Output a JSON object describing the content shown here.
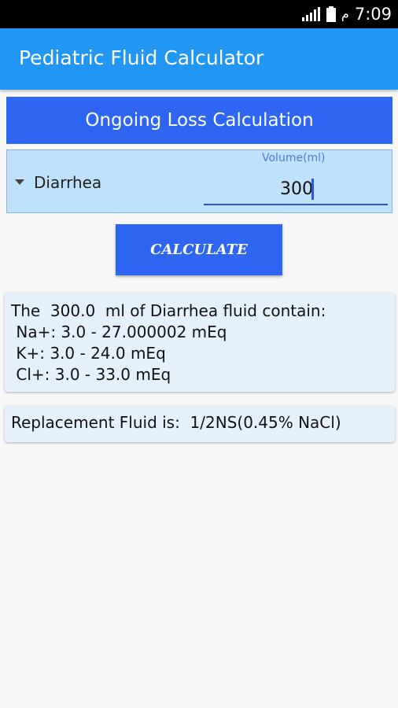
{
  "status_bar": {
    "time": "7:09",
    "arabic_indicator": "م"
  },
  "app_bar": {
    "title": "Pediatric Fluid Calculator"
  },
  "section": {
    "title": "Ongoing Loss Calculation"
  },
  "input": {
    "loss_type": "Diarrhea",
    "volume_label": "Volume(ml)",
    "volume_value": "300"
  },
  "calculate_label": "CALCULATE",
  "result": {
    "lines": [
      "The  300.0  ml of Diarrhea fluid contain:",
      " Na+: 3.0 - 27.000002 mEq",
      " K+: 3.0 - 24.0 mEq",
      " Cl+: 3.0 - 33.0 mEq"
    ]
  },
  "replacement": {
    "text": "Replacement Fluid is:  1/2NS(0.45% NaCl)"
  },
  "colors": {
    "app_bar": "#2196f3",
    "accent": "#2e65f3",
    "panel": "#bfe1fb",
    "card": "#e4f1fc"
  }
}
